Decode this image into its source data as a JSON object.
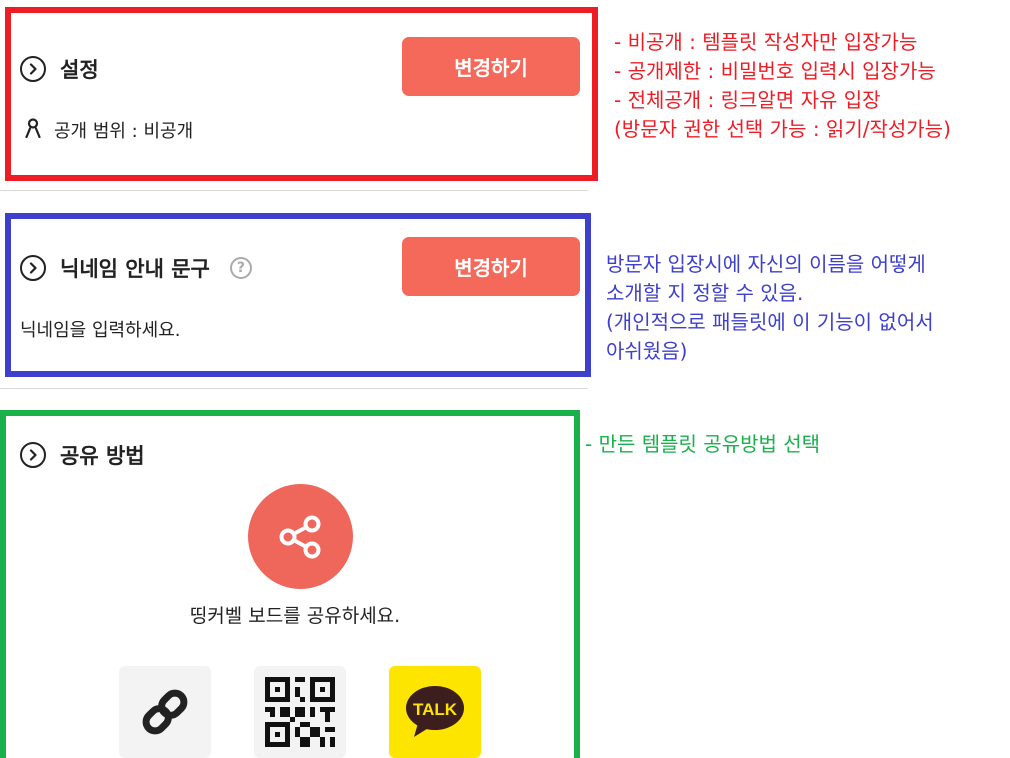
{
  "settings": {
    "title": "설정",
    "change_button": "변경하기",
    "visibility": "공개 범위 : 비공개"
  },
  "nickname": {
    "title": "닉네임 안내 문구",
    "help": "?",
    "change_button": "변경하기",
    "text": "닉네임을 입력하세요."
  },
  "share": {
    "title": "공유 방법",
    "description": "띵커벨 보드를 공유하세요.",
    "options": [
      {
        "icon": "link-icon"
      },
      {
        "icon": "qr-code-icon"
      },
      {
        "icon": "kakaotalk-icon",
        "label": "TALK"
      }
    ]
  },
  "annotations": {
    "red": [
      "- 비공개 : 템플릿 작성자만 입장가능",
      "- 공개제한 : 비밀번호 입력시 입장가능",
      "- 전체공개 : 링크알면 자유 입장",
      "(방문자 권한 선택 가능 : 읽기/작성가능)"
    ],
    "blue": [
      "방문자 입장시에 자신의 이름을 어떻게",
      "소개할 지 정할 수 있음.",
      "(개인적으로 패들릿에 이 기능이 없어서",
      "아쉬웠음)"
    ],
    "green": [
      "- 만든 템플릿 공유방법 선택"
    ]
  },
  "colors": {
    "red_box": "#ee1c24",
    "blue_box": "#3e3fcd",
    "green_box": "#1ab04c",
    "button": "#f4695a",
    "share_circle": "#ef665b",
    "kakao": "#fde500"
  }
}
